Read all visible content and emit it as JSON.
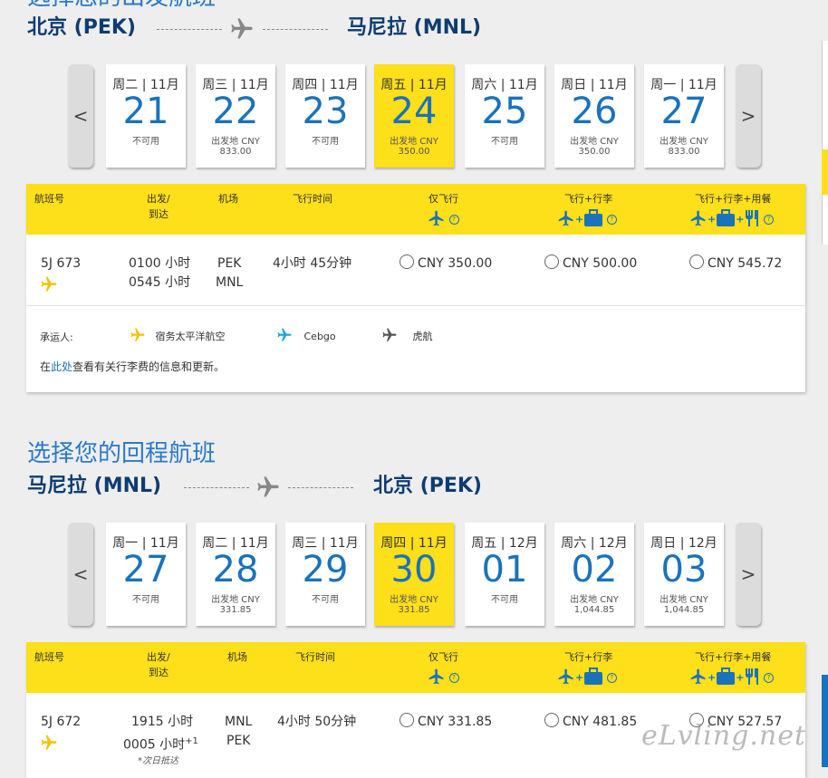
{
  "outbound": {
    "title": "选择您的出发航班",
    "from": "北京 (PEK)",
    "to": "马尼拉 (MNL)",
    "prev": "<",
    "next": ">",
    "days": [
      {
        "head": "周二 | 11月",
        "num": "21",
        "label": "不可用",
        "price": ""
      },
      {
        "head": "周三 | 11月",
        "num": "22",
        "label": "出发地 CNY",
        "price": "833.00"
      },
      {
        "head": "周四 | 11月",
        "num": "23",
        "label": "不可用",
        "price": ""
      },
      {
        "head": "周五 | 11月",
        "num": "24",
        "label": "出发地 CNY",
        "price": "350.00"
      },
      {
        "head": "周六 | 11月",
        "num": "25",
        "label": "不可用",
        "price": ""
      },
      {
        "head": "周日 | 11月",
        "num": "26",
        "label": "出发地 CNY",
        "price": "350.00"
      },
      {
        "head": "周一 | 11月",
        "num": "27",
        "label": "出发地 CNY",
        "price": "833.00"
      }
    ],
    "header": {
      "flight": "航班号",
      "depart1": "出发/",
      "depart2": "到达",
      "airport": "机场",
      "duration": "飞行时间",
      "fare1": "仅飞行",
      "fare2": "飞行+行李",
      "fare3": "飞行+行李+用餐"
    },
    "flight": {
      "no": "5J 673",
      "dep": "0100 小时",
      "arr": "0545 小时",
      "ap1": "PEK",
      "ap2": "MNL",
      "dur": "4小时 45分钟",
      "p1": "CNY 350.00",
      "p2": "CNY 500.00",
      "p3": "CNY 545.72"
    },
    "carrier_label": "承运人:",
    "carriers": [
      "宿务太平洋航空",
      "Cebgo",
      "虎航"
    ],
    "note_pre": "在",
    "note_link": "此处",
    "note_post": "查看有关行李费的信息和更新。"
  },
  "inbound": {
    "title": "选择您的回程航班",
    "from": "马尼拉 (MNL)",
    "to": "北京 (PEK)",
    "prev": "<",
    "next": ">",
    "days": [
      {
        "head": "周一 | 11月",
        "num": "27",
        "label": "不可用",
        "price": ""
      },
      {
        "head": "周二 | 11月",
        "num": "28",
        "label": "出发地 CNY",
        "price": "331.85"
      },
      {
        "head": "周三 | 11月",
        "num": "29",
        "label": "不可用",
        "price": ""
      },
      {
        "head": "周四 | 11月",
        "num": "30",
        "label": "出发地 CNY",
        "price": "331.85"
      },
      {
        "head": "周五 | 12月",
        "num": "01",
        "label": "不可用",
        "price": ""
      },
      {
        "head": "周六 | 12月",
        "num": "02",
        "label": "出发地 CNY",
        "price": "1,044.85"
      },
      {
        "head": "周日 | 12月",
        "num": "03",
        "label": "出发地 CNY",
        "price": "1,044.85"
      }
    ],
    "header": {
      "flight": "航班号",
      "depart1": "出发/",
      "depart2": "到达",
      "airport": "机场",
      "duration": "飞行时间",
      "fare1": "仅飞行",
      "fare2": "飞行+行李",
      "fare3": "飞行+行李+用餐"
    },
    "flight": {
      "no": "5J 672",
      "dep": "1915 小时",
      "arr": "0005 小时",
      "plus": "+1",
      "next_day": "*次日抵达",
      "ap1": "MNL",
      "ap2": "PEK",
      "dur": "4小时 50分钟",
      "p1": "CNY 331.85",
      "p2": "CNY 481.85",
      "p3": "CNY 527.57"
    }
  },
  "watermark": "eLvling.net",
  "colors": {
    "accent_yellow": "#fddf1a",
    "blue": "#1a72bb",
    "navy": "#0d3c71"
  }
}
